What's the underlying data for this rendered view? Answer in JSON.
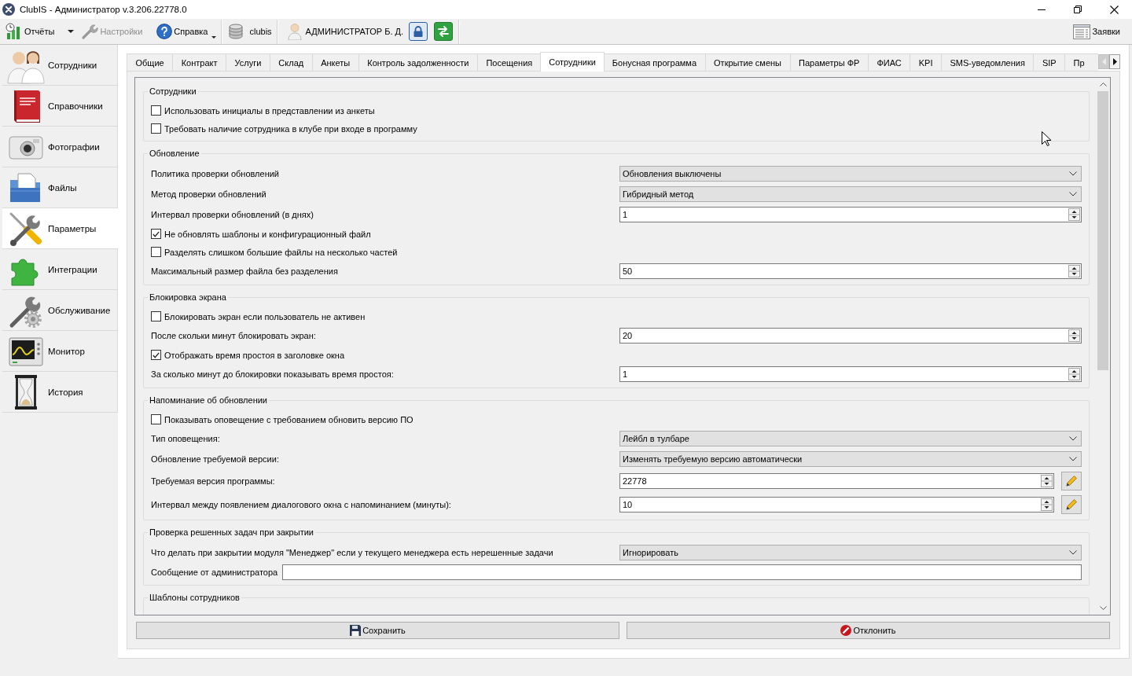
{
  "window": {
    "title": "ClubIS - Администратор v.3.206.22778.0"
  },
  "toolbar": {
    "reports": {
      "label": "Отчёты",
      "disabled": false
    },
    "settings": {
      "label": "Настройки",
      "disabled": true
    },
    "help": {
      "label": "Справка",
      "disabled": false
    },
    "database": {
      "label": "clubis"
    },
    "user": {
      "label": "АДМИНИСТРАТОР Б. Д."
    },
    "requests": {
      "label": "Заявки"
    }
  },
  "sidebar": {
    "items": [
      {
        "label": "Сотрудники",
        "selected": false
      },
      {
        "label": "Справочники",
        "selected": false
      },
      {
        "label": "Фотографии",
        "selected": false
      },
      {
        "label": "Файлы",
        "selected": false
      },
      {
        "label": "Параметры",
        "selected": true
      },
      {
        "label": "Интеграции",
        "selected": false
      },
      {
        "label": "Обслуживание",
        "selected": false
      },
      {
        "label": "Монитор",
        "selected": false
      },
      {
        "label": "История",
        "selected": false
      }
    ]
  },
  "tabs": [
    {
      "label": "Общие",
      "selected": false
    },
    {
      "label": "Контракт",
      "selected": false
    },
    {
      "label": "Услуги",
      "selected": false
    },
    {
      "label": "Склад",
      "selected": false
    },
    {
      "label": "Анкеты",
      "selected": false
    },
    {
      "label": "Контроль задолженности",
      "selected": false
    },
    {
      "label": "Посещения",
      "selected": false
    },
    {
      "label": "Сотрудники",
      "selected": true
    },
    {
      "label": "Бонусная программа",
      "selected": false
    },
    {
      "label": "Открытие смены",
      "selected": false
    },
    {
      "label": "Параметры ФР",
      "selected": false
    },
    {
      "label": "ФИАС",
      "selected": false
    },
    {
      "label": "KPI",
      "selected": false
    },
    {
      "label": "SMS-уведомления",
      "selected": false
    },
    {
      "label": "SIP",
      "selected": false
    },
    {
      "label": "Пр",
      "selected": false
    }
  ],
  "tab_scroll": {
    "back_disabled": true,
    "forward_disabled": false
  },
  "sections": [
    {
      "title": "Сотрудники",
      "rows": [
        {
          "kind": "checkbox",
          "label": "Использовать инициалы в представлении из анкеты",
          "checked": false
        },
        {
          "kind": "checkbox",
          "label": "Требовать наличие сотрудника в клубе при входе в программу",
          "checked": false
        }
      ]
    },
    {
      "title": "Обновление",
      "rows": [
        {
          "kind": "select",
          "label": "Политика проверки обновлений",
          "value": "Обновления выключены"
        },
        {
          "kind": "select",
          "label": "Метод проверки обновлений",
          "value": "Гибридный метод"
        },
        {
          "kind": "spin",
          "label": "Интервал проверки обновлений (в днях)",
          "value": "1"
        },
        {
          "kind": "checkbox",
          "label": "Не обновлять шаблоны и конфигурационный файл",
          "checked": true
        },
        {
          "kind": "checkbox",
          "label": "Разделять слишком большие файлы на несколько частей",
          "checked": false
        },
        {
          "kind": "spin",
          "label": "Максимальный размер файла без разделения",
          "value": "50"
        }
      ]
    },
    {
      "title": "Блокировка экрана",
      "rows": [
        {
          "kind": "checkbox",
          "label": "Блокировать экран если пользователь не активен",
          "checked": false
        },
        {
          "kind": "spin",
          "label": "После скольки минут блокировать экран:",
          "value": "20"
        },
        {
          "kind": "checkbox",
          "label": "Отображать время простоя в заголовке окна",
          "checked": true
        },
        {
          "kind": "spin",
          "label": "За сколько минут до блокировки показывать время простоя:",
          "value": "1"
        }
      ]
    },
    {
      "title": "Напоминание об обновлении",
      "rows": [
        {
          "kind": "checkbox",
          "label": "Показывать оповещение с требованием обновить версию ПО",
          "checked": false
        },
        {
          "kind": "select",
          "label": "Тип оповещения:",
          "value": "Лейбл в тулбаре"
        },
        {
          "kind": "select",
          "label": "Обновление требуемой версии:",
          "value": "Изменять требуемую версию автоматически"
        },
        {
          "kind": "spin-edit",
          "label": "Требуемая версия программы:",
          "value": "22778"
        },
        {
          "kind": "spin-edit",
          "label": "Интервал между появлением диалогового окна с напоминанием (минуты):",
          "value": "10"
        }
      ]
    },
    {
      "title": "Проверка решенных задач при закрытии",
      "rows": [
        {
          "kind": "select",
          "label": "Что делать при закрытии модуля \"Менеджер\" если у текущего менеджера есть нерешенные задачи",
          "value": "Игнорировать"
        },
        {
          "kind": "text",
          "label": "Сообщение от администратора"
        }
      ]
    },
    {
      "title": "Шаблоны сотрудников"
    }
  ],
  "footer": {
    "buttons": [
      {
        "kind": "save",
        "label": "Сохранить"
      },
      {
        "kind": "reject",
        "label": "Отклонить"
      }
    ]
  }
}
